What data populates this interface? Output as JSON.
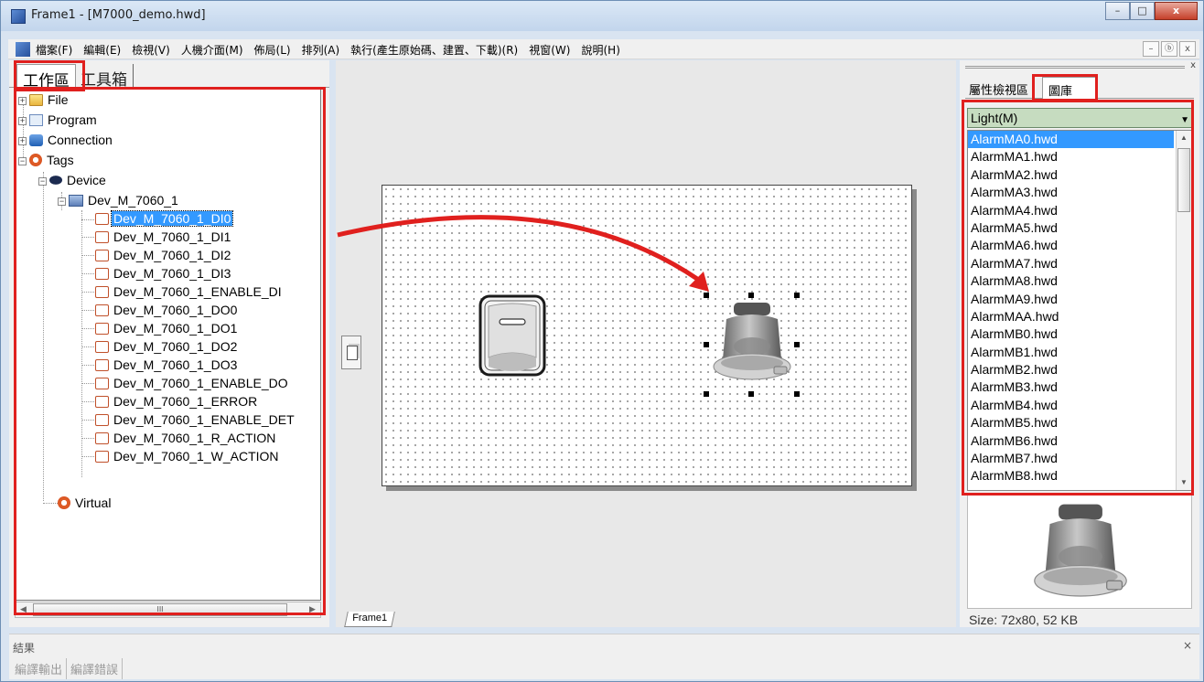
{
  "window": {
    "title": "Frame1 - [M7000_demo.hwd]",
    "min": "–",
    "max": "□",
    "close": "x"
  },
  "menu": [
    "檔案(F)",
    "編輯(E)",
    "檢視(V)",
    "人機介面(M)",
    "佈局(L)",
    "排列(A)",
    "執行(產生原始碼、建置、下載)(R)",
    "視窗(W)",
    "說明(H)"
  ],
  "mdi": {
    "min": "–",
    "restore": "ⓑ",
    "close": "x"
  },
  "left_tabs": {
    "workspace": "工作區",
    "toolbox": "工具箱"
  },
  "tree": {
    "file": "File",
    "program": "Program",
    "connection": "Connection",
    "tags": "Tags",
    "device": "Device",
    "dev": "Dev_M_7060_1",
    "items": [
      "Dev_M_7060_1_DI0",
      "Dev_M_7060_1_DI1",
      "Dev_M_7060_1_DI2",
      "Dev_M_7060_1_DI3",
      "Dev_M_7060_1_ENABLE_DI",
      "Dev_M_7060_1_DO0",
      "Dev_M_7060_1_DO1",
      "Dev_M_7060_1_DO2",
      "Dev_M_7060_1_DO3",
      "Dev_M_7060_1_ENABLE_DO",
      "Dev_M_7060_1_ERROR",
      "Dev_M_7060_1_ENABLE_DET",
      "Dev_M_7060_1_R_ACTION",
      "Dev_M_7060_1_W_ACTION"
    ],
    "virtual": "Virtual",
    "scroll_thumb": "III"
  },
  "canvas": {
    "frame_tab": "Frame1"
  },
  "right_tabs": {
    "properties": "屬性檢視區",
    "gallery": "圖庫"
  },
  "gallery": {
    "category": "Light(M)",
    "files": [
      "AlarmMA0.hwd",
      "AlarmMA1.hwd",
      "AlarmMA2.hwd",
      "AlarmMA3.hwd",
      "AlarmMA4.hwd",
      "AlarmMA5.hwd",
      "AlarmMA6.hwd",
      "AlarmMA7.hwd",
      "AlarmMA8.hwd",
      "AlarmMA9.hwd",
      "AlarmMAA.hwd",
      "AlarmMB0.hwd",
      "AlarmMB1.hwd",
      "AlarmMB2.hwd",
      "AlarmMB3.hwd",
      "AlarmMB4.hwd",
      "AlarmMB5.hwd",
      "AlarmMB6.hwd",
      "AlarmMB7.hwd",
      "AlarmMB8.hwd"
    ],
    "size_info": "Size: 72x80, 52 KB"
  },
  "results": {
    "title": "結果",
    "close": "×",
    "tabs": [
      "編譯輸出",
      "編譯錯誤"
    ]
  },
  "colors": {
    "highlight": "#e0201e",
    "selection": "#3399ff",
    "combo": "#c6dcc0"
  }
}
